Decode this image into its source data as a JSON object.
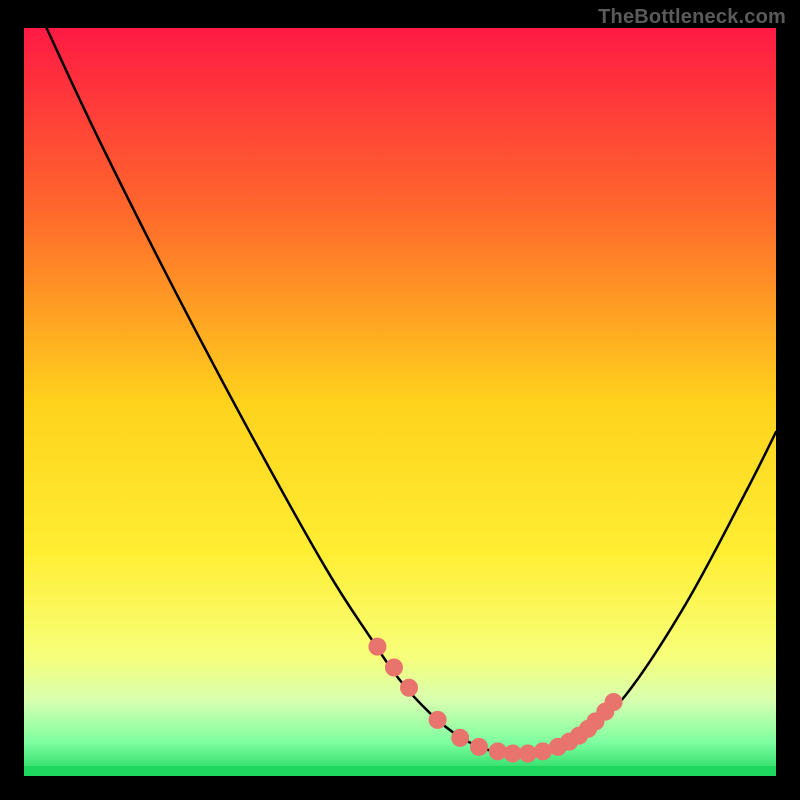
{
  "watermark": "TheBottleneck.com",
  "colors": {
    "background": "#000000",
    "curve": "#000000",
    "marker_fill": "#e8746d",
    "marker_stroke": "#e8746d",
    "green_band": "#1fd65f"
  },
  "chart_data": {
    "type": "line",
    "title": "",
    "xlabel": "",
    "ylabel": "",
    "xlim": [
      0,
      100
    ],
    "ylim": [
      0,
      100
    ],
    "gradient_stops": [
      {
        "offset": 0.0,
        "color": "#ff1a44"
      },
      {
        "offset": 0.25,
        "color": "#ff6a2b"
      },
      {
        "offset": 0.5,
        "color": "#ffd21c"
      },
      {
        "offset": 0.7,
        "color": "#ffee33"
      },
      {
        "offset": 0.84,
        "color": "#f7ff7a"
      },
      {
        "offset": 0.9,
        "color": "#d6ffb0"
      },
      {
        "offset": 0.955,
        "color": "#7effa0"
      },
      {
        "offset": 1.0,
        "color": "#1fd65f"
      }
    ],
    "series": [
      {
        "name": "bottleneck-curve",
        "x": [
          3.0,
          10.0,
          20.0,
          30.0,
          40.0,
          46.0,
          50.0,
          54.0,
          58.0,
          62.0,
          66.0,
          70.0,
          74.0,
          80.0,
          88.0,
          96.0,
          100.0
        ],
        "y": [
          100.0,
          85.0,
          65.0,
          46.0,
          28.0,
          18.6,
          12.8,
          8.4,
          5.2,
          3.4,
          3.0,
          3.4,
          5.2,
          10.8,
          23.0,
          38.0,
          46.0
        ]
      }
    ],
    "markers": {
      "name": "highlighted-points",
      "x": [
        47.0,
        49.2,
        51.2,
        55.0,
        58.0,
        60.5,
        63.0,
        65.0,
        67.0,
        69.0,
        71.0,
        72.5,
        73.8,
        75.0,
        76.0,
        77.3,
        78.4
      ],
      "y": [
        17.3,
        14.5,
        11.8,
        7.5,
        5.1,
        3.9,
        3.3,
        3.0,
        3.0,
        3.3,
        3.9,
        4.6,
        5.4,
        6.3,
        7.3,
        8.6,
        9.9
      ]
    }
  }
}
